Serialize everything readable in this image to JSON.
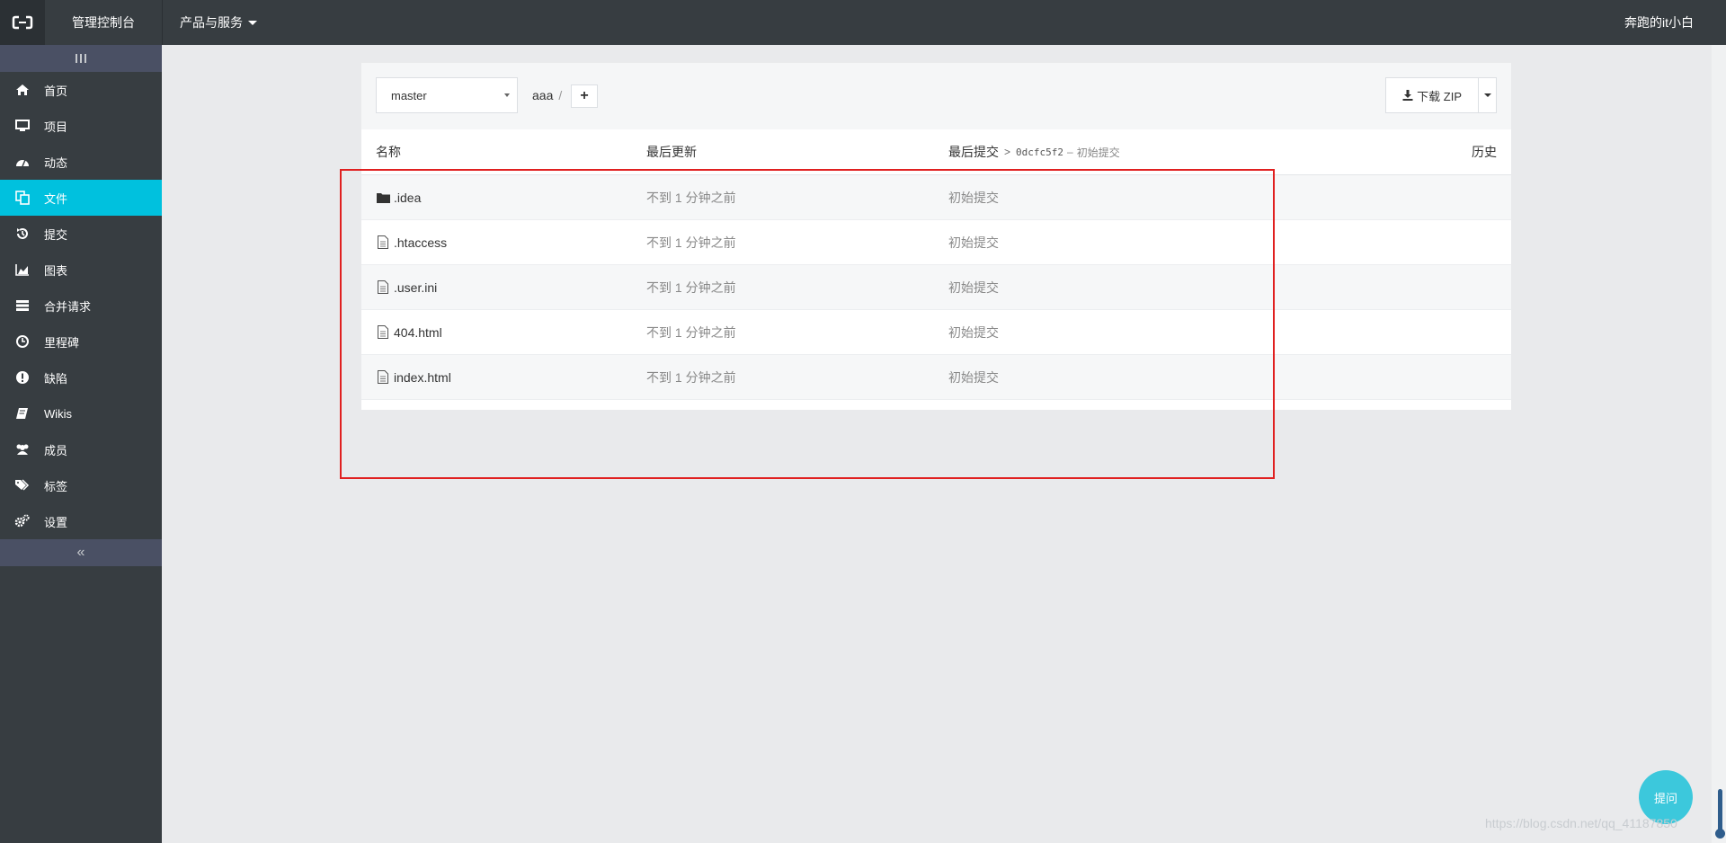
{
  "header": {
    "logo_icon": "aliyun-logo-icon",
    "console_title": "管理控制台",
    "products_menu": "产品与服务",
    "user": "奔跑的it小白"
  },
  "sidebar": {
    "toggle_icon": "grip-lines-icon",
    "items": [
      {
        "label": "首页",
        "icon": "home-icon"
      },
      {
        "label": "项目",
        "icon": "monitor-icon"
      },
      {
        "label": "动态",
        "icon": "dashboard-icon"
      },
      {
        "label": "文件",
        "icon": "files-icon",
        "active": true
      },
      {
        "label": "提交",
        "icon": "history-icon"
      },
      {
        "label": "图表",
        "icon": "area-chart-icon"
      },
      {
        "label": "合并请求",
        "icon": "server-icon"
      },
      {
        "label": "里程碑",
        "icon": "clock-icon"
      },
      {
        "label": "缺陷",
        "icon": "alert-icon"
      },
      {
        "label": "Wikis",
        "icon": "book-icon"
      },
      {
        "label": "成员",
        "icon": "users-icon"
      },
      {
        "label": "标签",
        "icon": "tags-icon"
      },
      {
        "label": "设置",
        "icon": "cogs-icon"
      }
    ],
    "collapse_label": "«"
  },
  "toolbar": {
    "branch": "master",
    "path_root": "aaa",
    "path_sep": "/",
    "add_label": "+",
    "download_label": "下载 ZIP"
  },
  "table": {
    "headers": {
      "name": "名称",
      "updated": "最后更新",
      "last_commit": "最后提交",
      "commit_hash": "0dcfc5f2",
      "commit_sep": "–",
      "commit_msg": "初始提交",
      "history": "历史"
    },
    "rows": [
      {
        "name": ".idea",
        "type": "folder",
        "updated": "不到 1 分钟之前",
        "commit": "初始提交"
      },
      {
        "name": ".htaccess",
        "type": "file",
        "updated": "不到 1 分钟之前",
        "commit": "初始提交"
      },
      {
        "name": ".user.ini",
        "type": "file",
        "updated": "不到 1 分钟之前",
        "commit": "初始提交"
      },
      {
        "name": "404.html",
        "type": "file",
        "updated": "不到 1 分钟之前",
        "commit": "初始提交"
      },
      {
        "name": "index.html",
        "type": "file",
        "updated": "不到 1 分钟之前",
        "commit": "初始提交"
      }
    ]
  },
  "ask_button": "提问",
  "watermark": "https://blog.csdn.net/qq_41187850",
  "colors": {
    "topbar": "#373d41",
    "active": "#00c1de",
    "highlight": "#e02020",
    "ask": "#3cc8dc"
  }
}
